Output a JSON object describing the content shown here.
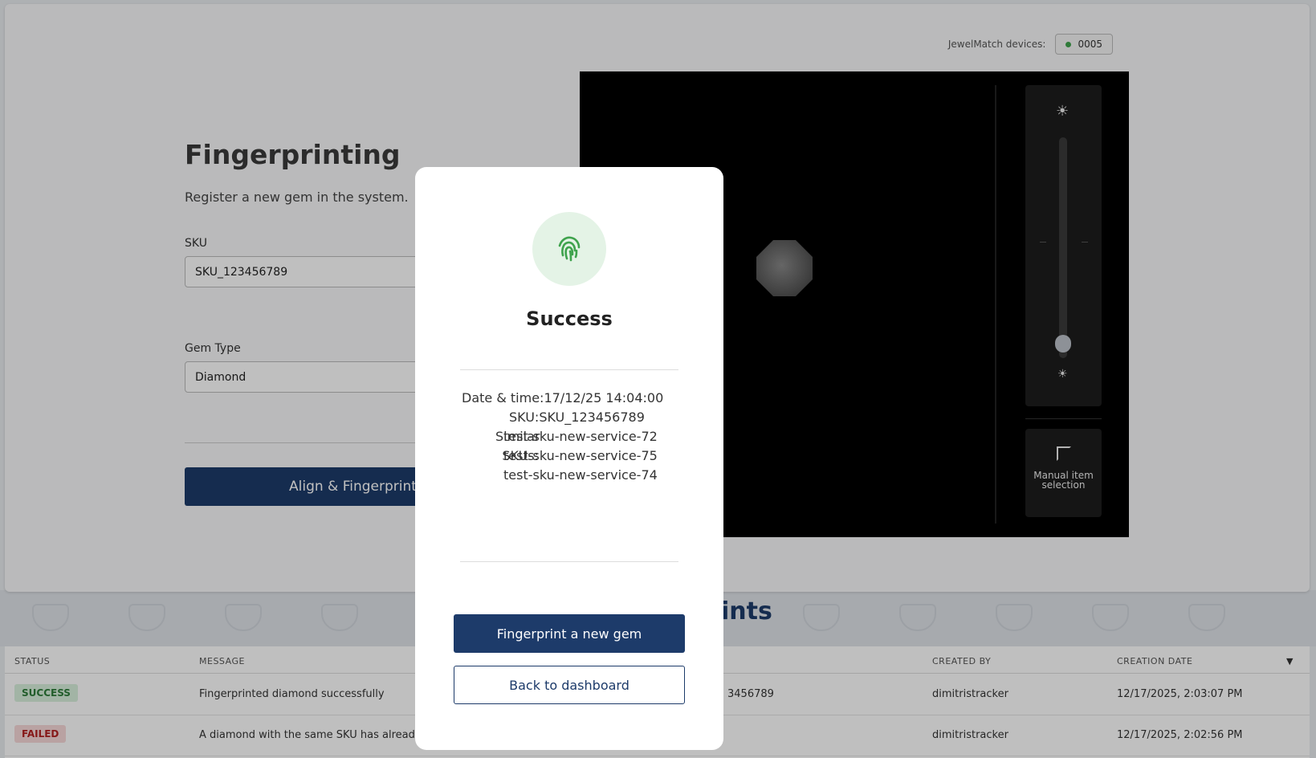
{
  "devices": {
    "label": "JewelMatch devices:",
    "device_id": "0005",
    "status_color": "#3fa34d"
  },
  "form": {
    "title": "Fingerprinting",
    "subtitle": "Register a new gem in the system.",
    "sku_label": "SKU",
    "sku_value": "SKU_123456789",
    "gem_type_label": "Gem Type",
    "gem_type_value": "Diamond",
    "submit_label": "Align & Fingerprint"
  },
  "camera": {
    "manual_selection_label": "Manual item selection",
    "brightness_level": 0.12
  },
  "history": {
    "heading_visible": "ints",
    "columns": [
      "STATUS",
      "MESSAGE",
      "CREATED BY",
      "CREATION DATE"
    ],
    "rows": [
      {
        "status": "SUCCESS",
        "message": "Fingerprinted diamond successfully",
        "sku_partial": "3456789",
        "created_by": "dimitristracker",
        "date": "12/17/2025, 2:03:07 PM"
      },
      {
        "status": "FAILED",
        "message": "A diamond with the same SKU has already be",
        "sku_partial": "",
        "created_by": "dimitristracker",
        "date": "12/17/2025, 2:02:56 PM"
      }
    ]
  },
  "modal": {
    "title": "Success",
    "date_label": "Date & time:",
    "date_value": "17/12/25 14:04:00",
    "sku_label": "SKU:",
    "sku_value": "SKU_123456789",
    "similar_label_1": "Similar",
    "similar_label_2": "SKUs:",
    "similar_skus": [
      "test-sku-new-service-72",
      "test-sku-new-service-75",
      "test-sku-new-service-74"
    ],
    "primary_label": "Fingerprint a new gem",
    "secondary_label": "Back to dashboard",
    "accent": "#1d3b6a",
    "icon_color": "#3fa34d"
  }
}
